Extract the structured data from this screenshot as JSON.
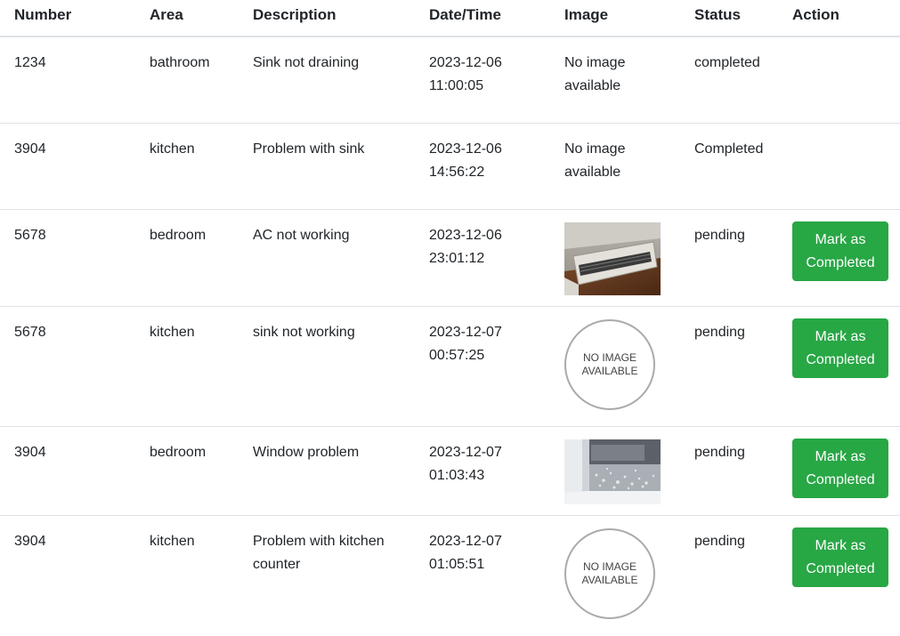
{
  "table": {
    "headers": [
      "Number",
      "Area",
      "Description",
      "Date/Time",
      "Image",
      "Status",
      "Action"
    ],
    "rows": [
      {
        "number": "1234",
        "area": "bathroom",
        "description": "Sink not draining",
        "date": "2023-12-06",
        "time": "11:00:05",
        "image_text": "No image available",
        "status": "completed"
      },
      {
        "number": "3904",
        "area": "kitchen",
        "description": "Problem with sink",
        "date": "2023-12-06",
        "time": "14:56:22",
        "image_text": "No image available",
        "status": "Completed"
      },
      {
        "number": "5678",
        "area": "bedroom",
        "description": "AC not working",
        "date": "2023-12-06",
        "time": "23:01:12",
        "image_alt": "AC unit photo",
        "status": "pending",
        "action": "Mark as Completed"
      },
      {
        "number": "5678",
        "area": "kitchen",
        "description": "sink not working",
        "date": "2023-12-07",
        "time": "00:57:25",
        "placeholder": "NO IMAGE AVAILABLE",
        "status": "pending",
        "action": "Mark as Completed"
      },
      {
        "number": "3904",
        "area": "bedroom",
        "description": "Window problem",
        "date": "2023-12-07",
        "time": "01:03:43",
        "image_alt": "Window condensation photo",
        "status": "pending",
        "action": "Mark as Completed"
      },
      {
        "number": "3904",
        "area": "kitchen",
        "description": "Problem with kitchen counter",
        "date": "2023-12-07",
        "time": "01:05:51",
        "placeholder": "NO IMAGE AVAILABLE",
        "status": "pending",
        "action": "Mark as Completed"
      }
    ]
  },
  "colors": {
    "button_bg": "#28a745",
    "button_text": "#ffffff",
    "row_border": "#dee2e6"
  }
}
